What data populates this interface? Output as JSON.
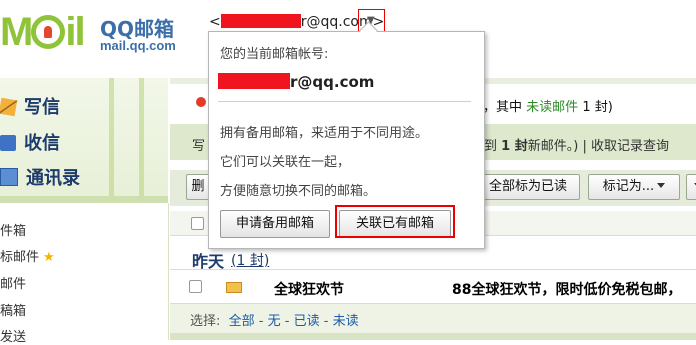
{
  "header": {
    "logo_mail": "MOil",
    "logo_brand": "QQ邮箱",
    "logo_domain": "mail.qq.com",
    "account_email_visible": "r@qq.com",
    "account_open": "<",
    "account_close": ">"
  },
  "sidebar": {
    "nav": [
      {
        "label": "写信",
        "icon": "pencil-icon"
      },
      {
        "label": "收信",
        "icon": "inbox-icon"
      },
      {
        "label": "通讯录",
        "icon": "contacts-icon"
      }
    ],
    "folders": [
      "件箱",
      "标邮件",
      "邮件",
      "稿箱",
      "发送"
    ]
  },
  "main": {
    "summary_prefix": "封，其中",
    "summary_unread_label": "未读邮件",
    "summary_count": "1 封)",
    "notice_left": "写",
    "notice_prefix": "到",
    "notice_count": "1 封",
    "notice_suffix": "新邮件。) | 收取记录查询",
    "toolbar": {
      "partial_left": "删",
      "mark_all_read": "全部标为已读",
      "mark_as": "标记为..."
    },
    "group": {
      "title": "昨天",
      "count": "(1 封)"
    },
    "mail": {
      "sender": "全球狂欢节",
      "subject": "88全球狂欢节，限时低价免税包邮，"
    },
    "select": {
      "label": "选择:",
      "all": "全部",
      "none": "无",
      "read": "已读",
      "unread": "未读",
      "sep": " - "
    }
  },
  "popover": {
    "title": "您的当前邮箱帐号:",
    "email_visible": "r@qq.com",
    "line1": "拥有备用邮箱，来适用于不同用途。",
    "line2": "它们可以关联在一起，",
    "line3": "方便随意切换不同的邮箱。",
    "btn_apply": "申请备用邮箱",
    "btn_link": "关联已有邮箱"
  },
  "colors": {
    "brand_green": "#8fc43a",
    "brand_blue": "#3b6fa8",
    "highlight_red": "#e00000",
    "redaction": "#f0141e"
  }
}
